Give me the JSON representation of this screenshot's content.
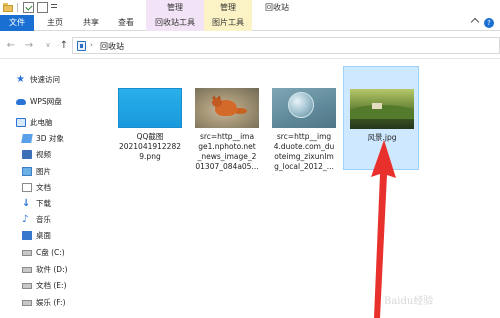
{
  "ribbon": {
    "context_groups": {
      "manage_1": "管理",
      "manage_2": "管理",
      "title": "回收站"
    },
    "tabs": {
      "file": "文件",
      "home": "主页",
      "share": "共享",
      "view": "查看",
      "recycle_tools": "回收站工具",
      "picture_tools": "图片工具"
    },
    "help": "?"
  },
  "address": {
    "path": "回收站"
  },
  "sidebar": {
    "items": [
      {
        "label": "快速访问",
        "icon": "quick-access-star-icon"
      },
      {
        "label": "WPS网盘",
        "icon": "wps-cloud-icon"
      },
      {
        "label": "此电脑",
        "icon": "this-pc-icon"
      },
      {
        "label": "3D 对象",
        "icon": "3d-objects-icon"
      },
      {
        "label": "视频",
        "icon": "videos-icon"
      },
      {
        "label": "图片",
        "icon": "pictures-icon"
      },
      {
        "label": "文档",
        "icon": "documents-icon"
      },
      {
        "label": "下载",
        "icon": "downloads-icon"
      },
      {
        "label": "音乐",
        "icon": "music-icon"
      },
      {
        "label": "桌面",
        "icon": "desktop-icon"
      },
      {
        "label": "C盘 (C:)",
        "icon": "drive-icon"
      },
      {
        "label": "软件 (D:)",
        "icon": "drive-icon"
      },
      {
        "label": "文档 (E:)",
        "icon": "drive-icon"
      },
      {
        "label": "娱乐 (F:)",
        "icon": "drive-icon"
      }
    ]
  },
  "files": [
    {
      "name": "QQ截图\n2021041912282\n9.png"
    },
    {
      "name": "src=http__ima\nge1.nphoto.net\n_news_image_2\n01307_084a05..."
    },
    {
      "name": "src=http__img\n4.duote.com_du\noteimg_zixunIm\ng_local_2012_..."
    },
    {
      "name": "风景.jpg"
    }
  ],
  "watermark": "Baidu经验",
  "colors": {
    "file_tab": "#1a6fd2",
    "manage_recycle": "#f3e3f6",
    "manage_picture": "#fbf3c6",
    "selection": "#cde8ff",
    "arrow": "#e8312c"
  }
}
